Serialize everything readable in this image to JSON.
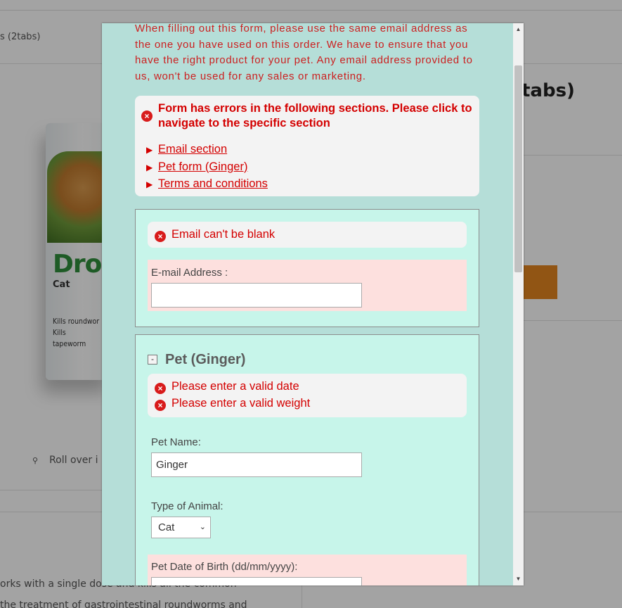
{
  "background": {
    "breadcrumb": "s (2tabs)",
    "title": "tabs)",
    "brand": "Dron",
    "brand_sub": "Cat",
    "kills_line1": "Kills roundwor",
    "kills_line2": "Kills tapeworm",
    "zoom_text": "Roll over i",
    "desc_line1": "orks with a single dose and kills all the common",
    "desc_line2": "the treatment of gastrointestinal roundworms and"
  },
  "modal": {
    "notice": "When filling out this form, please use the same email address as the one you have used on this order. We have to ensure that you have the right product for your pet. Any email address provided to us, won't be used for any sales or marketing.",
    "error_summary": {
      "title": "Form has errors in the following sections. Please click to navigate to the specific section",
      "links": [
        "Email section",
        "Pet form (Ginger)",
        "Terms and conditions"
      ]
    },
    "email_section": {
      "error": "Email can't be blank",
      "label": "E-mail Address :",
      "value": ""
    },
    "pet_section": {
      "collapse_symbol": "-",
      "title": "Pet (Ginger)",
      "errors": [
        "Please enter a valid date",
        "Please enter a valid weight"
      ],
      "name_label": "Pet Name:",
      "name_value": "Ginger",
      "type_label": "Type of Animal:",
      "type_value": "Cat",
      "dob_label": "Pet Date of Birth (dd/mm/yyyy):"
    }
  },
  "icons": {
    "error": "error-x-icon",
    "arrow": "triangle-right-icon",
    "scroll_up": "scroll-up-icon",
    "scroll_down": "scroll-down-icon",
    "zoom": "magnifier-icon"
  },
  "colors": {
    "modal_bg": "#b5ded8",
    "section_bg": "#c7f5ea",
    "error_red": "#d40000",
    "invalid_field_bg": "#fde0de",
    "add_to_cart": "#e38520"
  }
}
